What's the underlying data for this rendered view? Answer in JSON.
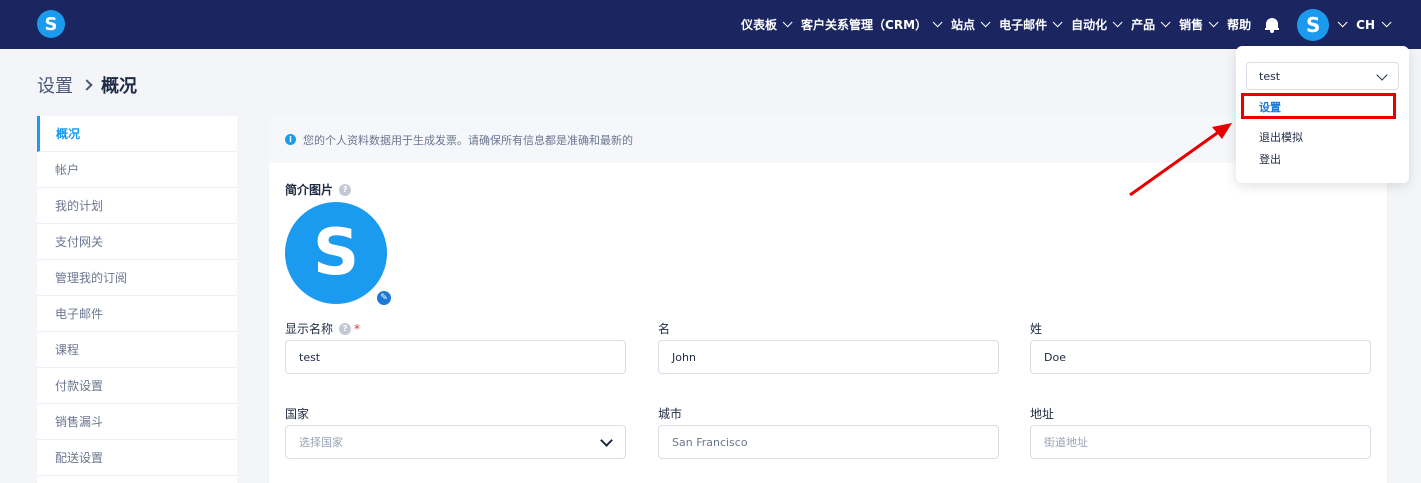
{
  "topbar": {
    "logo_letter": "S",
    "nav_items": [
      "仪表板",
      "客户关系管理（CRM）",
      "站点",
      "电子邮件",
      "自动化",
      "产品",
      "销售",
      "帮助"
    ],
    "avatar_letter": "S",
    "language": "CH",
    "colors": {
      "bar": "#1b2560",
      "accent": "#1b9bf0"
    }
  },
  "breadcrumb": {
    "parent": "设置",
    "current": "概况"
  },
  "sidebar": {
    "items": [
      "概况",
      "帐户",
      "我的计划",
      "支付网关",
      "管理我的订阅",
      "电子邮件",
      "课程",
      "付款设置",
      "销售漏斗",
      "配送设置"
    ],
    "active_index": 0
  },
  "main": {
    "notice": "您的个人资料数据用于生成发票。请确保所有信息都是准确和最新的",
    "profile_picture": {
      "title": "简介图片",
      "letter": "S"
    },
    "fields": {
      "display_name": {
        "label": "显示名称",
        "required_mark": "*",
        "value": "test"
      },
      "first_name": {
        "label": "名",
        "value": "John"
      },
      "last_name": {
        "label": "姓",
        "value": "Doe"
      },
      "country": {
        "label": "国家",
        "placeholder": "选择国家"
      },
      "city": {
        "label": "城市",
        "value": "San Francisco"
      },
      "address": {
        "label": "地址",
        "placeholder": "街道地址"
      }
    }
  },
  "account_menu": {
    "account_select": "test",
    "items": [
      "设置",
      "退出模拟",
      "登出"
    ],
    "highlighted": "设置"
  }
}
